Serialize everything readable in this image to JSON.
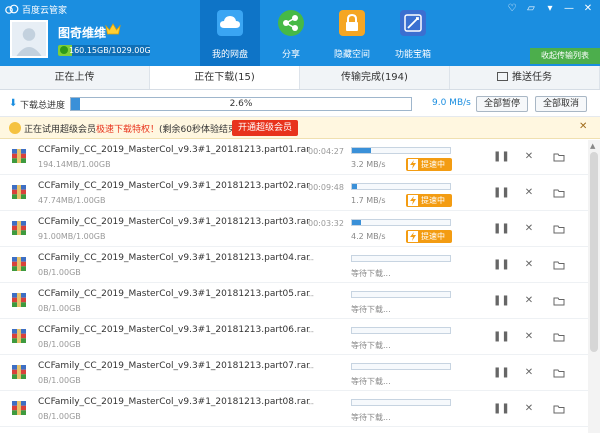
{
  "app": {
    "title": "百度云管家"
  },
  "user": {
    "name": "图奇维维",
    "quota_text": "160.15GB/1029.00GB",
    "quota_used_fraction": 0.156
  },
  "nav": [
    {
      "label": "我的网盘",
      "icon": "cloud-icon",
      "color": "#3aa5f3"
    },
    {
      "label": "分享",
      "icon": "share-icon",
      "color": "#46b946"
    },
    {
      "label": "隐藏空间",
      "icon": "lock-icon",
      "color": "#f5a623"
    },
    {
      "label": "功能宝箱",
      "icon": "toolbox-icon",
      "color": "#3b6fd1"
    }
  ],
  "gift_button": "收起传输列表",
  "tabs": [
    {
      "label": "正在上传"
    },
    {
      "label": "正在下载(15)"
    },
    {
      "label": "传输完成(194)"
    },
    {
      "label": "推送任务"
    }
  ],
  "progress": {
    "label": "下载总进度",
    "percent_text": "2.6%",
    "percent": 2.6,
    "speed": "9.0 MB/s",
    "pause_all": "全部暂停",
    "cancel_all": "全部取消"
  },
  "notice": {
    "text_before": "正在试用超级会员",
    "highlight": "极速下载特权！",
    "text_after": "(剩余60秒体验结束)",
    "button": "开通超级会员"
  },
  "accel_label": "提速中",
  "downloads": [
    {
      "name": "CCFamily_CC_2019_MasterCol_v9.3#1_20181213.part01.rar",
      "size": "194.14MB/1.00GB",
      "time": "00:04:27",
      "speed": "3.2 MB/s",
      "progress": 0.19,
      "accel": true
    },
    {
      "name": "CCFamily_CC_2019_MasterCol_v9.3#1_20181213.part02.rar",
      "size": "47.74MB/1.00GB",
      "time": "00:09:48",
      "speed": "1.7 MB/s",
      "progress": 0.05,
      "accel": true
    },
    {
      "name": "CCFamily_CC_2019_MasterCol_v9.3#1_20181213.part03.rar",
      "size": "91.00MB/1.00GB",
      "time": "00:03:32",
      "speed": "4.2 MB/s",
      "progress": 0.09,
      "accel": true
    },
    {
      "name": "CCFamily_CC_2019_MasterCol_v9.3#1_20181213.part04.rar",
      "size": "0B/1.00GB",
      "time": "--",
      "speed": "等待下载...",
      "progress": 0,
      "accel": false
    },
    {
      "name": "CCFamily_CC_2019_MasterCol_v9.3#1_20181213.part05.rar",
      "size": "0B/1.00GB",
      "time": "--",
      "speed": "等待下载...",
      "progress": 0,
      "accel": false
    },
    {
      "name": "CCFamily_CC_2019_MasterCol_v9.3#1_20181213.part06.rar",
      "size": "0B/1.00GB",
      "time": "--",
      "speed": "等待下载...",
      "progress": 0,
      "accel": false
    },
    {
      "name": "CCFamily_CC_2019_MasterCol_v9.3#1_20181213.part07.rar",
      "size": "0B/1.00GB",
      "time": "--",
      "speed": "等待下载...",
      "progress": 0,
      "accel": false
    },
    {
      "name": "CCFamily_CC_2019_MasterCol_v9.3#1_20181213.part08.rar",
      "size": "0B/1.00GB",
      "time": "--",
      "speed": "等待下载...",
      "progress": 0,
      "accel": false
    }
  ]
}
